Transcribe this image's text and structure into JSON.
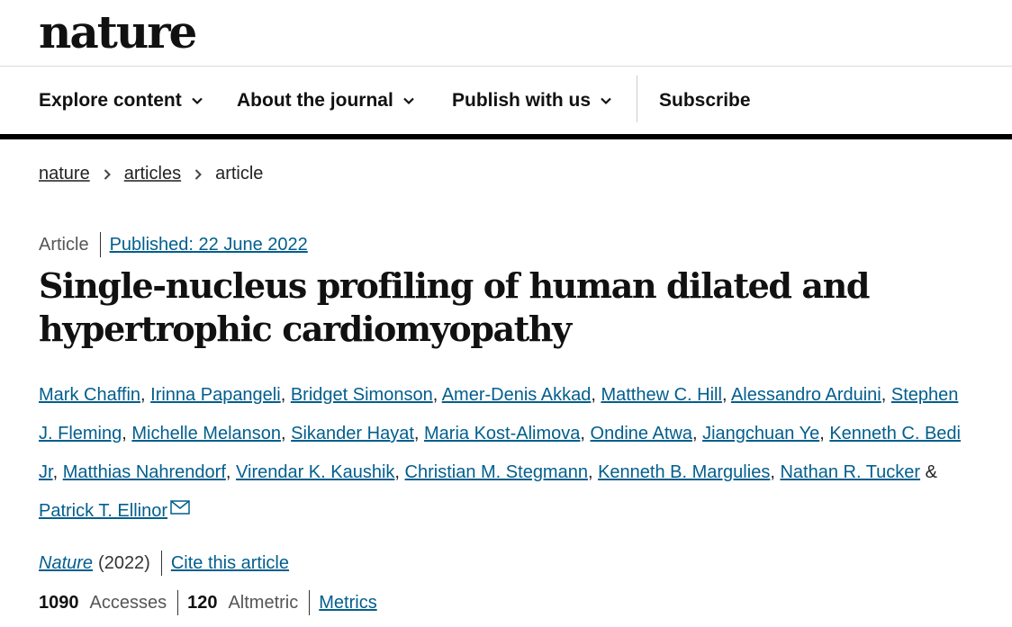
{
  "logo": {
    "text": "nature"
  },
  "nav": {
    "items": [
      {
        "label": "Explore content"
      },
      {
        "label": "About the journal"
      },
      {
        "label": "Publish with us"
      }
    ],
    "subscribe": "Subscribe"
  },
  "breadcrumb": {
    "items": [
      "nature",
      "articles"
    ],
    "current": "article"
  },
  "article": {
    "type": "Article",
    "published": "Published: 22 June 2022",
    "title": "Single-nucleus profiling of human dilated and hypertrophic cardiomyopathy",
    "authors": [
      "Mark Chaffin",
      "Irinna Papangeli",
      "Bridget Simonson",
      "Amer-Denis Akkad",
      "Matthew C. Hill",
      "Alessandro Arduini",
      "Stephen J. Fleming",
      "Michelle Melanson",
      "Sikander Hayat",
      "Maria Kost-Alimova",
      "Ondine Atwa",
      "Jiangchuan Ye",
      "Kenneth C. Bedi Jr",
      "Matthias Nahrendorf",
      "Virendar K. Kaushik",
      "Christian M. Stegmann",
      "Kenneth B. Margulies",
      "Nathan R. Tucker",
      "Patrick T. Ellinor"
    ],
    "separator": ", ",
    "last_separator": " & ",
    "journal": "Nature",
    "year": "(2022)",
    "cite": "Cite this article",
    "metrics": {
      "accesses_value": "1090",
      "accesses_label": "Accesses",
      "altmetric_value": "120",
      "altmetric_label": "Altmetric",
      "metrics_link": "Metrics"
    }
  },
  "colors": {
    "link": "#025e8d",
    "text": "#222222",
    "rule": "#000000"
  }
}
